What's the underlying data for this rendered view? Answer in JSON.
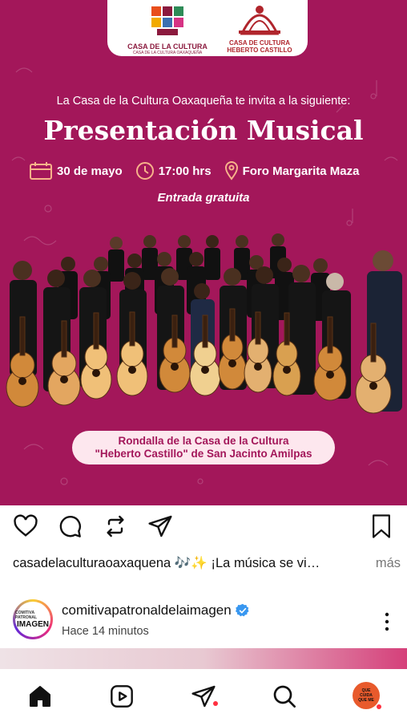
{
  "post": {
    "logos": {
      "left_name": "CASA DE LA CULTURA",
      "left_sub": "CASA DE LA CULTURA OAXAQUEÑA",
      "right_line1": "CASA DE CULTURA",
      "right_line2": "HEBERTO CASTILLO"
    },
    "invite": "La Casa de la Cultura Oaxaqueña te invita a la siguiente:",
    "title": "Presentación Musical",
    "date": "30 de mayo",
    "time": "17:00 hrs",
    "venue": "Foro Margarita Maza",
    "entry": "Entrada gratuita",
    "caption_line1": "Rondalla de la Casa de la Cultura",
    "caption_line2": "\"Heberto Castillo\" de San Jacinto Amilpas",
    "colors": {
      "background": "#a3175a",
      "pill": "#fde7ee",
      "accent_text": "#a3175a"
    }
  },
  "actions": {
    "icons": [
      "heart-icon",
      "comment-icon",
      "repost-icon",
      "share-icon",
      "bookmark-icon"
    ]
  },
  "caption": {
    "username": "casadelaculturaoaxaquena",
    "text": " 🎶✨ ¡La música se vi…",
    "more": "más"
  },
  "next_post": {
    "avatar_line1": "COMITIVA PATRONAL",
    "avatar_line2": "IMAGEN",
    "username": "comitivapatronaldelaimagen",
    "verified": true,
    "time": "Hace 14 minutos"
  },
  "nav": {
    "items": [
      "home-icon",
      "reels-icon",
      "messages-icon",
      "search-icon",
      "profile-avatar"
    ],
    "profile_avatar_text": "QUE CUIDA QUE ME"
  }
}
